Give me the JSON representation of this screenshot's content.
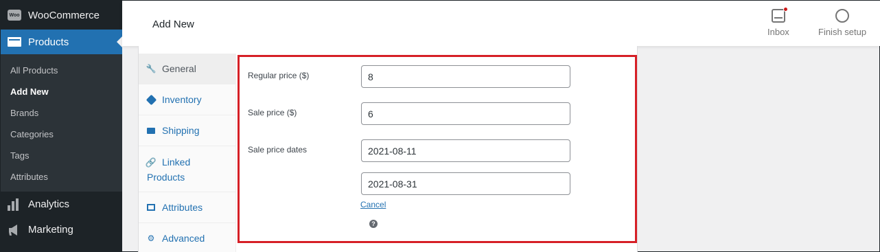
{
  "sidebar": {
    "woocommerce_label": "WooCommerce",
    "woo_logo_text": "Woo",
    "products_label": "Products",
    "sub_items": [
      "All Products",
      "Add New",
      "Brands",
      "Categories",
      "Tags",
      "Attributes"
    ],
    "analytics_label": "Analytics",
    "marketing_label": "Marketing"
  },
  "header": {
    "title": "Add New",
    "inbox_label": "Inbox",
    "finish_setup_label": "Finish setup"
  },
  "tabs": {
    "general": "General",
    "inventory": "Inventory",
    "shipping": "Shipping",
    "linked_products_1": "Linked",
    "linked_products_2": "Products",
    "attributes": "Attributes",
    "advanced": "Advanced"
  },
  "pricing": {
    "regular_price_label": "Regular price ($)",
    "regular_price_value": "8",
    "sale_price_label": "Sale price ($)",
    "sale_price_value": "6",
    "sale_dates_label": "Sale price dates",
    "sale_date_from": "2021-08-11",
    "sale_date_to": "2021-08-31",
    "cancel_label": "Cancel",
    "help_icon": "?"
  },
  "colors": {
    "accent": "#2271b1",
    "sidebar_bg": "#1d2327",
    "highlight_border": "#d61f26",
    "notification_dot": "#cc1818"
  }
}
